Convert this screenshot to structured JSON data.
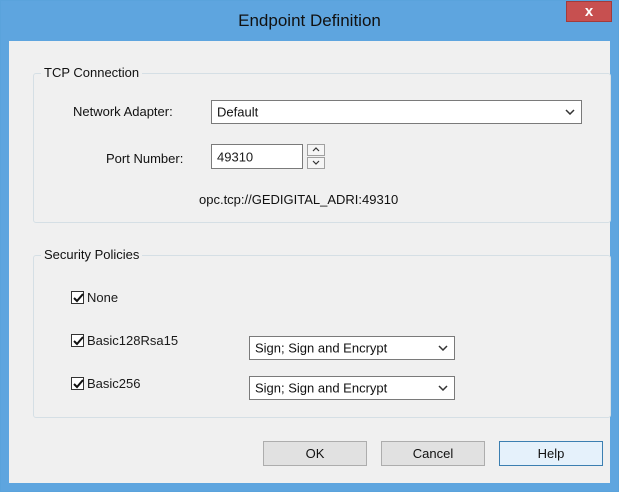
{
  "window": {
    "title": "Endpoint Definition",
    "close_label": "x"
  },
  "tcp": {
    "group_label": "TCP Connection",
    "adapter_label": "Network Adapter:",
    "adapter_value": "Default",
    "port_label": "Port Number:",
    "port_value": "49310",
    "endpoint_url": "opc.tcp://GEDIGITAL_ADRI:49310"
  },
  "security": {
    "group_label": "Security Policies",
    "policies": [
      {
        "label": "None",
        "checked": true
      },
      {
        "label": "Basic128Rsa15",
        "checked": true,
        "mode": "Sign; Sign and Encrypt"
      },
      {
        "label": "Basic256",
        "checked": true,
        "mode": "Sign; Sign and Encrypt"
      }
    ]
  },
  "buttons": {
    "ok": "OK",
    "cancel": "Cancel",
    "help": "Help"
  },
  "colors": {
    "titlebar": "#5ea5df",
    "close": "#c75050",
    "dialog_bg": "#f0f0f0"
  },
  "icons": {
    "dropdown": "chevron-down-icon",
    "spin_up": "caret-up-icon",
    "spin_down": "caret-down-icon",
    "check": "checkmark-icon"
  }
}
